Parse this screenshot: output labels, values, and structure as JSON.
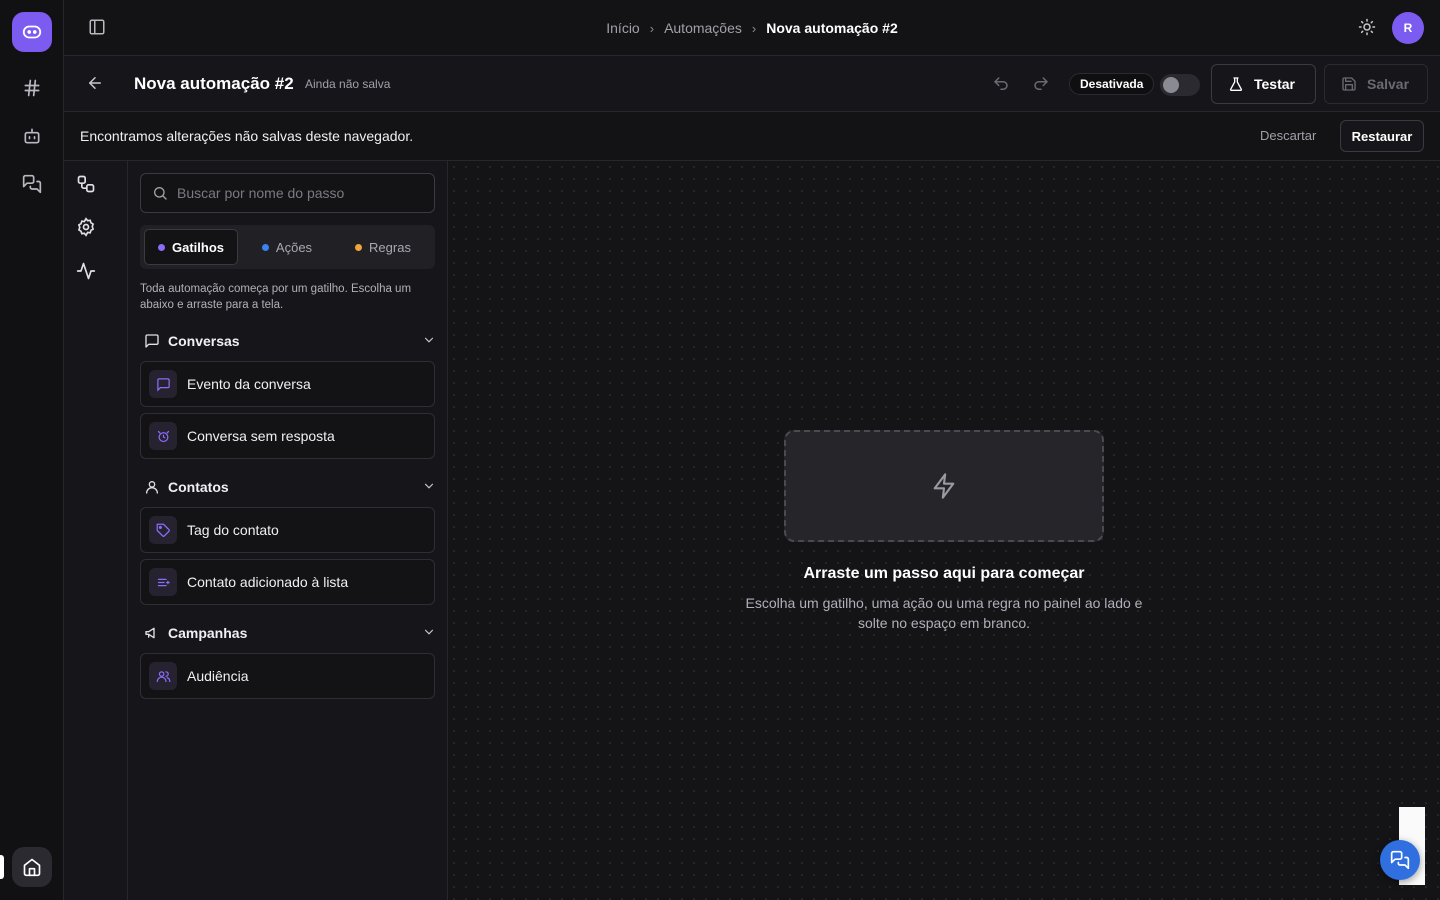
{
  "breadcrumb": {
    "items": [
      "Início",
      "Automações"
    ],
    "current": "Nova automação #2"
  },
  "user": {
    "initial": "R"
  },
  "header": {
    "title": "Nova automação #2",
    "save_state": "Ainda não salva",
    "status_label": "Desativada",
    "test_label": "Testar",
    "save_label": "Salvar"
  },
  "banner": {
    "message": "Encontramos alterações não salvas deste navegador.",
    "discard_label": "Descartar",
    "restore_label": "Restaurar"
  },
  "panel": {
    "search_placeholder": "Buscar por nome do passo",
    "tabs": [
      {
        "label": "Gatilhos",
        "color": "#8b6cf6"
      },
      {
        "label": "Ações",
        "color": "#3b82f6"
      },
      {
        "label": "Regras",
        "color": "#f0a43a"
      }
    ],
    "hint": "Toda automação começa por um gatilho. Escolha um abaixo e arraste para a tela.",
    "groups": [
      {
        "label": "Conversas",
        "icon": "message-square-icon",
        "items": [
          {
            "label": "Evento da conversa",
            "icon": "message-square-icon"
          },
          {
            "label": "Conversa sem resposta",
            "icon": "alarm-clock-icon"
          }
        ]
      },
      {
        "label": "Contatos",
        "icon": "user-icon",
        "items": [
          {
            "label": "Tag do contato",
            "icon": "tag-icon"
          },
          {
            "label": "Contato adicionado à lista",
            "icon": "list-icon"
          }
        ]
      },
      {
        "label": "Campanhas",
        "icon": "megaphone-icon",
        "items": [
          {
            "label": "Audiência",
            "icon": "users-icon"
          }
        ]
      }
    ]
  },
  "canvas": {
    "drop_icon": "zap-icon",
    "drop_title": "Arraste um passo aqui para começar",
    "drop_subtitle_line1": "Escolha um gatilho, uma ação ou uma regra no painel ao lado e",
    "drop_subtitle_line2": "solte no espaço em branco."
  },
  "colors": {
    "accent": "#7c5cf0",
    "chat_button": "#2f6fe0"
  }
}
